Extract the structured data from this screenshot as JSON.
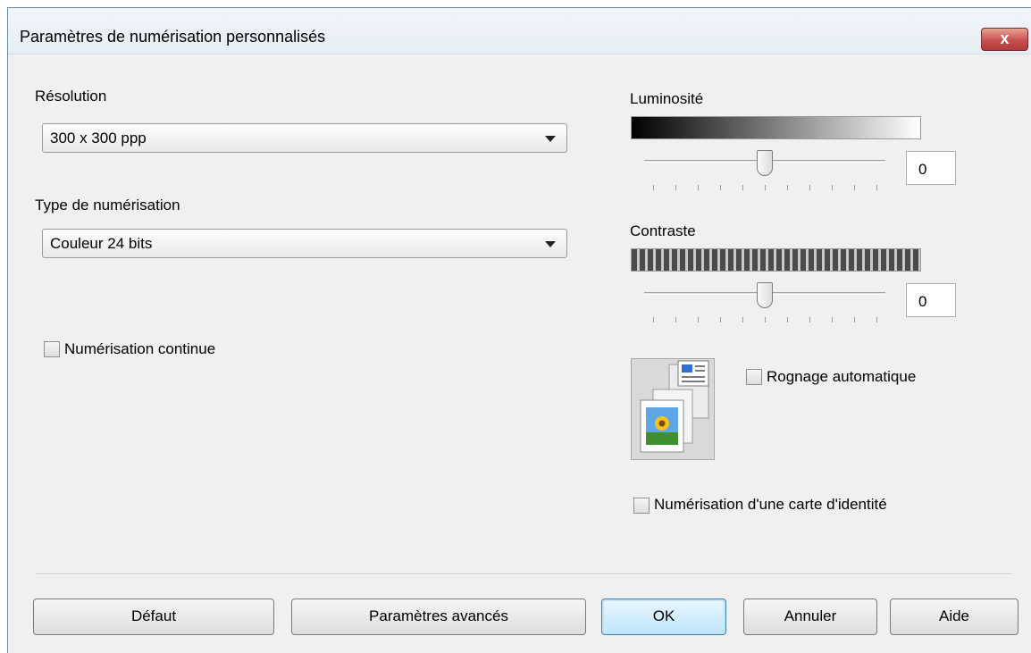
{
  "window": {
    "title": "Paramètres de numérisation personnalisés",
    "close_glyph": "x"
  },
  "left": {
    "resolution_label": "Résolution",
    "resolution_value": "300 x 300 ppp",
    "scan_type_label": "Type de numérisation",
    "scan_type_value": "Couleur 24 bits",
    "continuous_label": "Numérisation continue",
    "continuous_checked": false
  },
  "right": {
    "brightness_label": "Luminosité",
    "brightness_value": "0",
    "brightness_level": 0.5,
    "contrast_label": "Contraste",
    "contrast_value": "0",
    "contrast_level": 0.5,
    "autocrop_label": "Rognage automatique",
    "autocrop_checked": false,
    "idcard_label": "Numérisation d'une carte d'identité",
    "idcard_checked": false,
    "preview_icon": "document-photo-icon"
  },
  "buttons": {
    "default_label": "Défaut",
    "advanced_label": "Paramètres avancés",
    "ok_label": "OK",
    "cancel_label": "Annuler",
    "help_label": "Aide"
  },
  "colors": {
    "close_button": "#c75050",
    "default_button_border": "#3c7fb1",
    "dialog_bg": "#f0f0f0"
  }
}
